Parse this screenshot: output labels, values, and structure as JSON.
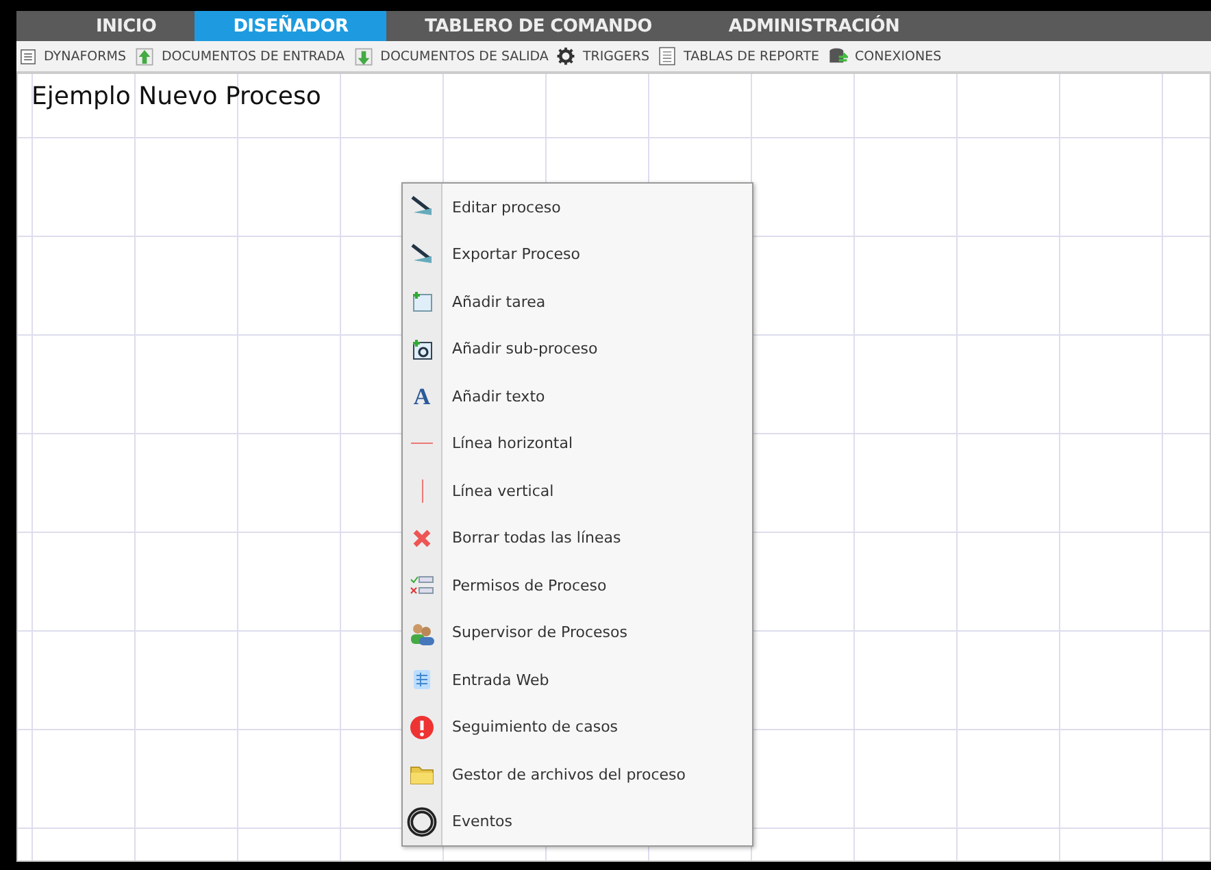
{
  "tabs": [
    {
      "label": "INICIO",
      "selected": false
    },
    {
      "label": "DISEÑADOR",
      "selected": true
    },
    {
      "label": "TABLERO DE COMANDO",
      "selected": false
    },
    {
      "label": "ADMINISTRACIÓN",
      "selected": false
    }
  ],
  "toolbar": [
    "DYNAFORMS",
    "DOCUMENTOS DE ENTRADA",
    "DOCUMENTOS DE SALIDA",
    "TRIGGERS",
    "TABLAS DE REPORTE",
    "CONEXIONES"
  ],
  "canvas": {
    "title": "Ejemplo Nuevo Proceso"
  },
  "context_menu": [
    "Editar proceso",
    "Exportar Proceso",
    "Añadir tarea",
    "Añadir sub-proceso",
    {
      "label": "Añadir texto",
      "icon_text": "A"
    },
    "Línea horizontal",
    "Línea vertical",
    "Borrar todas las líneas",
    "Permisos de Proceso",
    "Supervisor de Procesos",
    "Entrada Web",
    "Seguimiento de casos",
    "Gestor de archivos del proceso",
    "Eventos"
  ]
}
